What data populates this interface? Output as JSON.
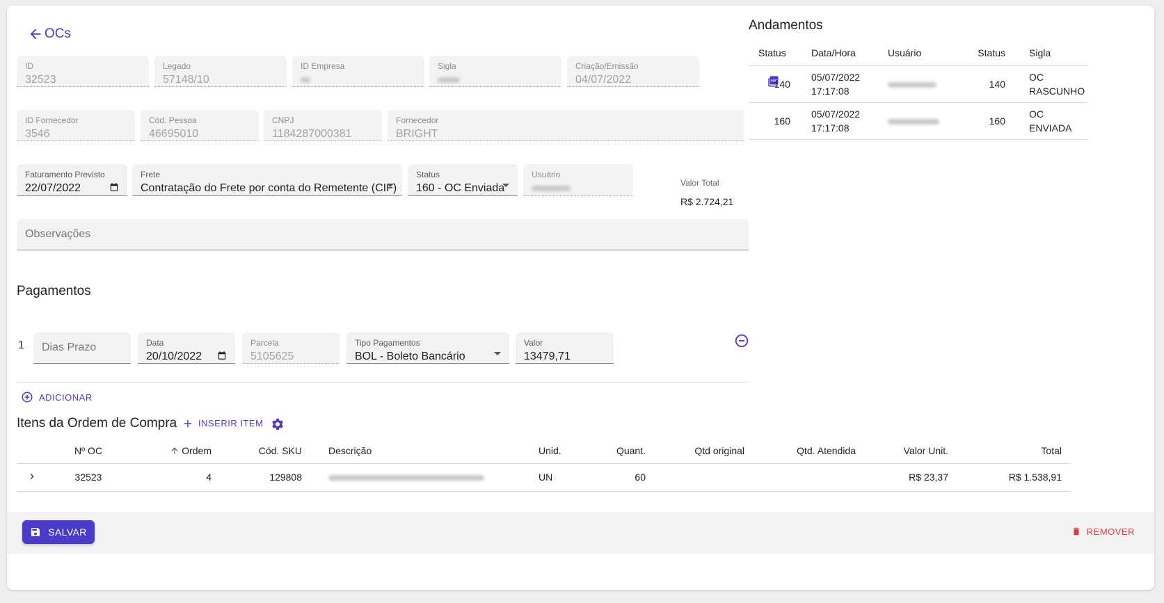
{
  "nav": {
    "back_label": "OCs"
  },
  "header_fields": {
    "id": {
      "label": "ID",
      "value": "32523"
    },
    "legado": {
      "label": "Legado",
      "value": "57148/10"
    },
    "id_empresa": {
      "label": "ID Empresa"
    },
    "sigla": {
      "label": "Sigla"
    },
    "criacao": {
      "label": "Criação/Emissão",
      "value": "04/07/2022"
    }
  },
  "supplier_fields": {
    "id_fornecedor": {
      "label": "ID Fornecedor",
      "value": "3546"
    },
    "cod_pessoa": {
      "label": "Cód. Pessoa",
      "value": "46695010"
    },
    "cnpj": {
      "label": "CNPJ",
      "value": "1184287000381"
    },
    "fornecedor": {
      "label": "Fornecedor",
      "value": "BRIGHT"
    }
  },
  "order_fields": {
    "faturamento": {
      "label": "Faturamento Previsto",
      "value": "22/07/2022"
    },
    "frete": {
      "label": "Frete",
      "value": "Contratação do Frete por conta do Remetente (CIF)"
    },
    "status": {
      "label": "Status",
      "value": "160 - OC Enviada"
    },
    "usuario": {
      "label": "Usuário"
    },
    "valor_total": {
      "label": "Valor Total",
      "value": "R$ 2.724,21"
    }
  },
  "observacoes": {
    "placeholder": "Observações"
  },
  "pagamentos": {
    "title": "Pagamentos",
    "index": "1",
    "dias_prazo": {
      "placeholder": "Dias Prazo"
    },
    "data": {
      "label": "Data",
      "value": "20/10/2022"
    },
    "parcela": {
      "label": "Parcela",
      "value": "5105625"
    },
    "tipo": {
      "label": "Tipo Pagamentos",
      "value": "BOL - Boleto Bancário"
    },
    "valor": {
      "label": "Valor",
      "value": "13479,71"
    },
    "add_label": "ADICIONAR"
  },
  "andamentos": {
    "title": "Andamentos",
    "columns": [
      "Status",
      "Data/Hora",
      "Usuário",
      "Status",
      "Sigla"
    ],
    "rows": [
      {
        "status": "140",
        "date": "05/07/2022",
        "time": "17:17:08",
        "status2": "140",
        "sigla1": "OC",
        "sigla2": "RASCUNHO"
      },
      {
        "status": "160",
        "date": "05/07/2022",
        "time": "17:17:08",
        "status2": "160",
        "sigla1": "OC",
        "sigla2": "ENVIADA"
      }
    ]
  },
  "itens": {
    "title": "Itens da Ordem de Compra",
    "insert_label": "INSERIR ITEM",
    "columns": [
      "Nº OC",
      "Ordem",
      "Cód. SKU",
      "Descrição",
      "Unid.",
      "Quant.",
      "Qtd original",
      "Qtd. Atendida",
      "Valor Unit.",
      "Total"
    ],
    "rows": [
      {
        "oc": "32523",
        "ordem": "4",
        "sku": "129808",
        "unid": "UN",
        "quant": "60",
        "qtd_original": "",
        "qtd_atendida": "",
        "valor_unit": "R$ 23,37",
        "total": "R$ 1.538,91"
      }
    ]
  },
  "footer": {
    "save_label": "SALVAR",
    "remove_label": "REMOVER"
  },
  "colors": {
    "accent": "#4a3bc9",
    "danger": "#e53935",
    "field_bg": "#f3f3f3"
  },
  "icons": [
    "arrow-left-icon",
    "pdf-icon",
    "calendar-icon",
    "chevron-down-icon",
    "minus-circle-icon",
    "plus-circle-icon",
    "plus-icon",
    "gear-icon",
    "chevron-right-icon",
    "arrow-up-icon",
    "save-icon",
    "trash-icon"
  ]
}
